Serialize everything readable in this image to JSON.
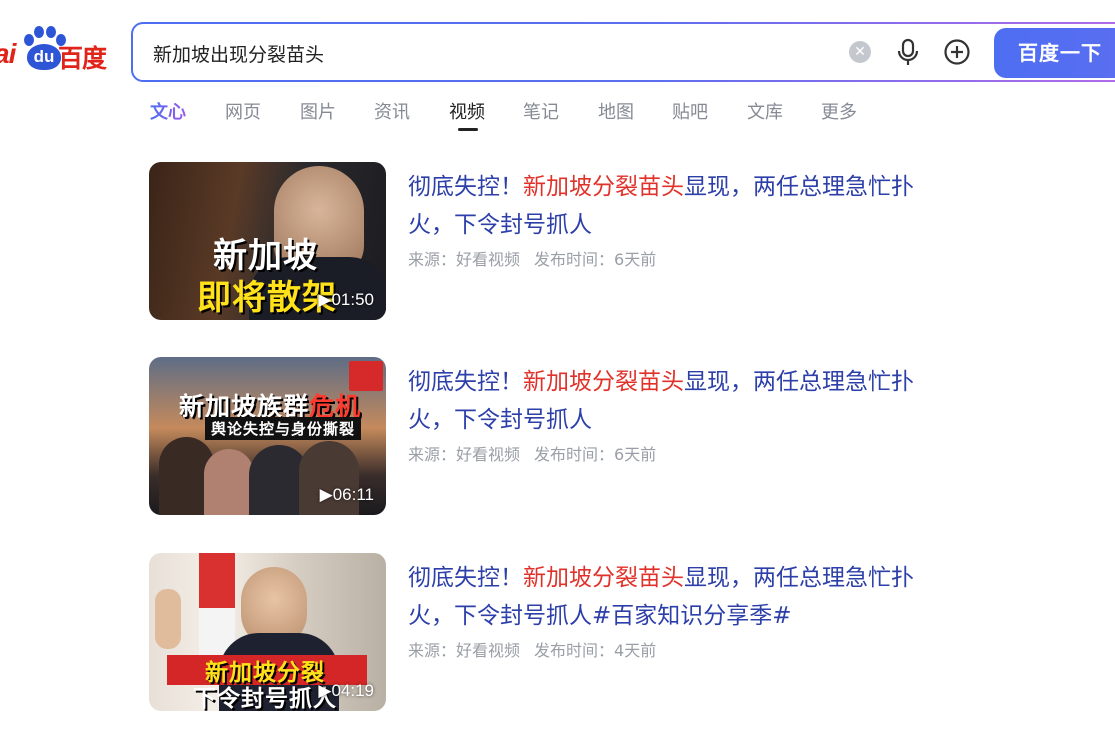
{
  "logo": {
    "ai": "ai",
    "du": "du",
    "cn": "百度"
  },
  "search": {
    "query": "新加坡出现分裂苗头",
    "clear_icon": "clear-icon",
    "mic_icon": "microphone-icon",
    "plus_icon": "add-circle-icon",
    "button_label": "百度一下"
  },
  "tabs": [
    {
      "label": "文心"
    },
    {
      "label": "网页"
    },
    {
      "label": "图片"
    },
    {
      "label": "资讯"
    },
    {
      "label": "视频"
    },
    {
      "label": "笔记"
    },
    {
      "label": "地图"
    },
    {
      "label": "贴吧"
    },
    {
      "label": "文库"
    },
    {
      "label": "更多"
    }
  ],
  "active_tab": "视频",
  "results": [
    {
      "title_pre": "彻底失控！",
      "title_hl": "新加坡分裂苗头",
      "title_post": "显现，两任总理急忙扑火，下令封号抓人",
      "source": "来源：好看视频",
      "time": "发布时间：6天前",
      "thumb_text_1": "新加坡",
      "thumb_text_2": "即将散架",
      "duration": "▶01:50"
    },
    {
      "title_pre": "彻底失控！",
      "title_hl": "新加坡分裂苗头",
      "title_post": "显现，两任总理急忙扑火，下令封号抓人",
      "source": "来源：好看视频",
      "time": "发布时间：6天前",
      "thumb_text_1": "新加坡族群",
      "thumb_text_1b": "危机",
      "thumb_text_2": "舆论失控与身份撕裂",
      "duration": "▶06:11"
    },
    {
      "title_pre": "彻底失控！",
      "title_hl": "新加坡分裂苗头",
      "title_post": "显现，两任总理急忙扑火，下令封号抓人#百家知识分享季#",
      "source": "来源：好看视频",
      "time": "发布时间：4天前",
      "thumb_text_1": "新加坡分裂",
      "thumb_text_2": "下令封号抓人",
      "duration": "▶04:19"
    }
  ],
  "colors": {
    "brand_blue": "#4e6ef2",
    "brand_red": "#e0241a",
    "title_blue": "#2d3fa8",
    "highlight_red": "#e0322a"
  }
}
